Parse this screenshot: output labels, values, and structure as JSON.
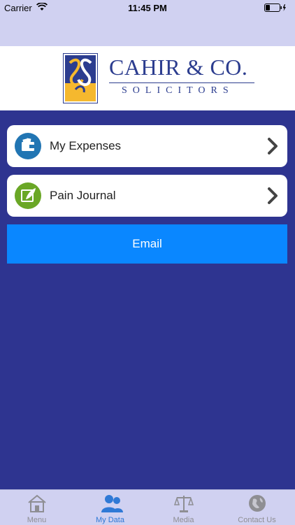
{
  "status": {
    "carrier": "Carrier",
    "time": "11:45 PM"
  },
  "logo": {
    "title": "CAHIR & CO.",
    "subtitle": "SOLICITORS"
  },
  "menu": [
    {
      "label": "My Expenses",
      "icon": "wallet-icon",
      "color": "#2175b3"
    },
    {
      "label": "Pain Journal",
      "icon": "journal-icon",
      "color": "#6aa726"
    }
  ],
  "email_label": "Email",
  "tabs": [
    {
      "label": "Menu",
      "icon": "home-icon",
      "active": false
    },
    {
      "label": "My Data",
      "icon": "users-icon",
      "active": true
    },
    {
      "label": "Media",
      "icon": "scales-icon",
      "active": false
    },
    {
      "label": "Contact Us",
      "icon": "globe-icon",
      "active": false
    }
  ],
  "colors": {
    "background": "#2e3490",
    "bars": "#d0d1f1",
    "email_button": "#0a87ff",
    "active_tab": "#2f79d6"
  }
}
